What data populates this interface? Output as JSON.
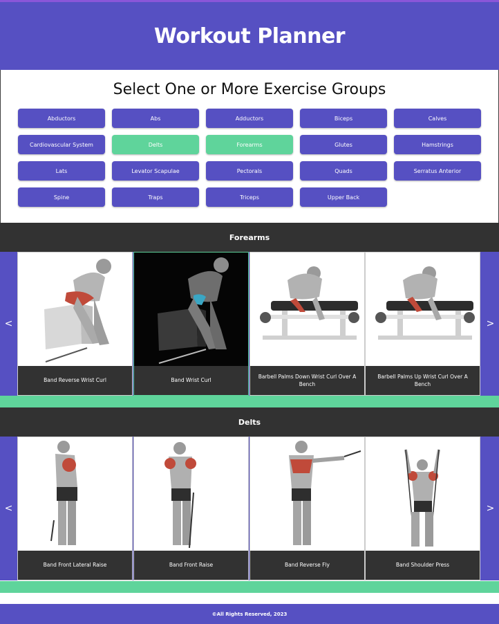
{
  "header": {
    "title": "Workout Planner"
  },
  "main": {
    "heading": "Select One or More Exercise Groups",
    "groups": [
      {
        "label": "Abductors",
        "selected": false
      },
      {
        "label": "Abs",
        "selected": false
      },
      {
        "label": "Adductors",
        "selected": false
      },
      {
        "label": "Biceps",
        "selected": false
      },
      {
        "label": "Calves",
        "selected": false
      },
      {
        "label": "Cardiovascular System",
        "selected": false
      },
      {
        "label": "Delts",
        "selected": true
      },
      {
        "label": "Forearms",
        "selected": true
      },
      {
        "label": "Glutes",
        "selected": false
      },
      {
        "label": "Hamstrings",
        "selected": false
      },
      {
        "label": "Lats",
        "selected": false
      },
      {
        "label": "Levator Scapulae",
        "selected": false
      },
      {
        "label": "Pectorals",
        "selected": false
      },
      {
        "label": "Quads",
        "selected": false
      },
      {
        "label": "Serratus Anterior",
        "selected": false
      },
      {
        "label": "Spine",
        "selected": false
      },
      {
        "label": "Traps",
        "selected": false
      },
      {
        "label": "Triceps",
        "selected": false
      },
      {
        "label": "Upper Back",
        "selected": false
      }
    ]
  },
  "sections": [
    {
      "title": "Forearms",
      "prev": "<",
      "next": ">",
      "cards": [
        {
          "caption": "Band Reverse Wrist Curl"
        },
        {
          "caption": "Band Wrist Curl"
        },
        {
          "caption": "Barbell Palms Down Wrist Curl Over A Bench"
        },
        {
          "caption": "Barbell Palms Up Wrist Curl Over A Bench"
        }
      ]
    },
    {
      "title": "Delts",
      "prev": "<",
      "next": ">",
      "cards": [
        {
          "caption": "Band Front Lateral Raise"
        },
        {
          "caption": "Band Front Raise"
        },
        {
          "caption": "Band Reverse Fly"
        },
        {
          "caption": "Band Shoulder Press"
        }
      ]
    }
  ],
  "footer": {
    "text": "©All Rights Reserved, 2023"
  },
  "colors": {
    "primary": "#5650c2",
    "selected": "#5fd49b",
    "dark": "#323232"
  }
}
